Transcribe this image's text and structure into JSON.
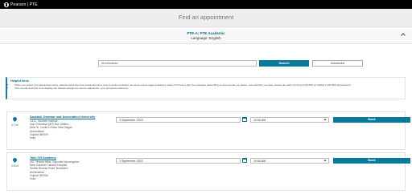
{
  "header": {
    "brand": "Pearson | PTE"
  },
  "page": {
    "title": "Find an appointment"
  },
  "exam": {
    "program": "PTE-A: PTE Academic",
    "language": "Language: English"
  },
  "search": {
    "value": "Ahmedabad",
    "button": "Search",
    "advanced": "Advanced"
  },
  "hints": {
    "title": "Helpful hints",
    "items": [
      "When you select your appointment time, double-check the time format and time zone to avoid confusion, as some events support delivery nearly 24 hours a day. For example, depending on time format you prefer, note whether you have chosen an early morning (1:00 AM) or midday (1:00 PM) appointment.",
      "Time format and time zone display use default settings but can be adjusted to your personal preference."
    ]
  },
  "results": [
    {
      "distance": "4.7 mi",
      "name": "Saurabh Jhanwar and Association University",
      "address": [
        "14/11, Saurabh institute,",
        "Opp Chanakya (IBT) Bus Station,",
        "Near St. Xavier's Road, Near Bagan",
        "Ahmedabad",
        "Gujarat 380009",
        "India"
      ],
      "date": "2 September 2022",
      "time": "10:00 AM",
      "book": "Book"
    },
    {
      "distance": "4.8 mi",
      "name": "Take Off Academy",
      "address": [
        "402, Sharda Mitra, Opposite Navrangpura",
        "Near Darshan Camera Hospital,",
        "Sindhu Bhavan Road, Bodakdev",
        "Ahmedabad",
        "Gujarat 380054",
        "India"
      ],
      "date": "2 September 2022",
      "time": "10:00 AM",
      "book": "Book"
    }
  ]
}
